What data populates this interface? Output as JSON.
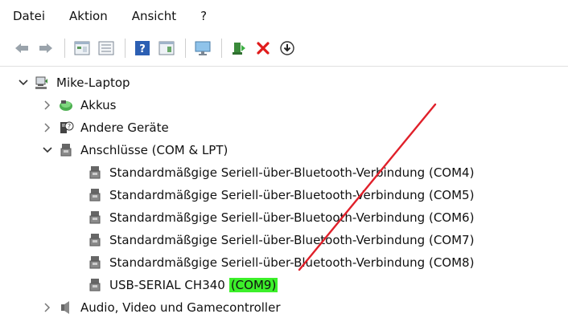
{
  "menu": {
    "items": [
      "Datei",
      "Aktion",
      "Ansicht",
      "?"
    ]
  },
  "toolbar": {
    "icons": [
      "back-arrow-icon",
      "forward-arrow-icon",
      "properties-icon",
      "list-icon",
      "help-icon",
      "console-icon",
      "monitor-icon",
      "update-driver-icon",
      "uninstall-icon",
      "download-icon"
    ]
  },
  "tree": {
    "root": "Mike-Laptop",
    "akkus": "Akkus",
    "andere": "Andere Geräte",
    "anschluesse": "Anschlüsse (COM & LPT)",
    "ports": [
      "Standardmäßgige Seriell-über-Bluetooth-Verbindung (COM4)",
      "Standardmäßgige Seriell-über-Bluetooth-Verbindung (COM5)",
      "Standardmäßgige Seriell-über-Bluetooth-Verbindung (COM6)",
      "Standardmäßgige Seriell-über-Bluetooth-Verbindung (COM7)",
      "Standardmäßgige Seriell-über-Bluetooth-Verbindung (COM8)"
    ],
    "usb_name": "USB-SERIAL CH340",
    "usb_port": "(COM9)",
    "audio": "Audio, Video und Gamecontroller"
  },
  "colors": {
    "highlight": "#3cf02a",
    "annotation_line": "#e0202a"
  }
}
